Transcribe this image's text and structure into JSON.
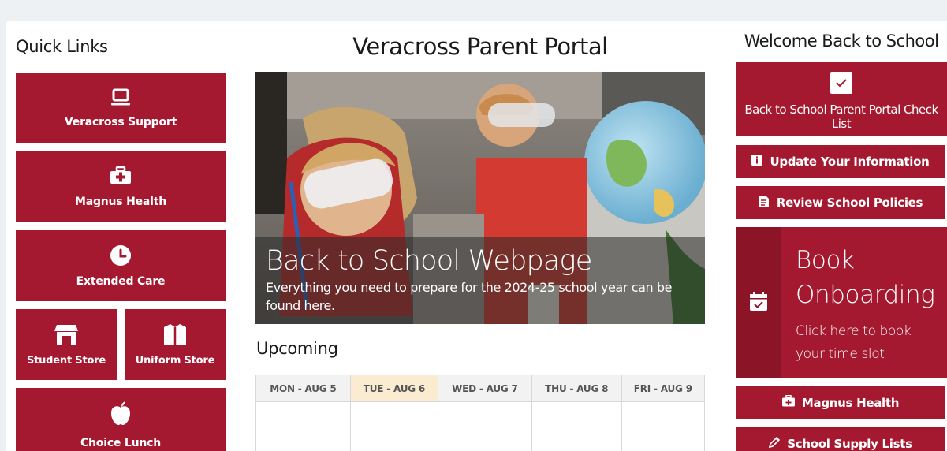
{
  "quick_links": {
    "title": "Quick Links",
    "items": [
      {
        "label": "Veracross Support",
        "icon": "laptop-icon"
      },
      {
        "label": "Magnus Health",
        "icon": "medical-kit-icon"
      },
      {
        "label": "Extended Care",
        "icon": "clock-icon"
      },
      {
        "label": "Student Store",
        "icon": "store-icon"
      },
      {
        "label": "Uniform Store",
        "icon": "shirt-icon"
      },
      {
        "label": "Choice Lunch",
        "icon": "apple-icon"
      }
    ]
  },
  "main": {
    "title": "Veracross Parent Portal",
    "hero": {
      "title": "Back to School Webpage",
      "subtitle": "Everything you need to prepare for the 2024-25 school year can be found here."
    },
    "upcoming": {
      "title": "Upcoming",
      "days": [
        "MON - AUG 5",
        "TUE - AUG 6",
        "WED - AUG 7",
        "THU - AUG 8",
        "FRI - AUG 9"
      ],
      "today_index": 1
    }
  },
  "welcome": {
    "title": "Welcome Back to School",
    "checklist": {
      "label": "Back to School Parent Portal Check List",
      "icon": "checkbox-icon"
    },
    "update_info": {
      "label": "Update Your Information",
      "icon": "info-book-icon"
    },
    "review_policies": {
      "label": "Review School Policies",
      "icon": "document-icon"
    },
    "book_onboarding": {
      "title": "Book Onboarding",
      "subtitle": "Click here to book your time slot",
      "icon": "calendar-check-icon"
    },
    "magnus_health": {
      "label": "Magnus Health",
      "icon": "medical-kit-icon"
    },
    "supply_lists": {
      "label": "School Supply Lists",
      "icon": "pencil-icon"
    }
  },
  "colors": {
    "accent": "#a4192f",
    "accent_dark": "#8b1426",
    "today": "#fbebd0"
  }
}
